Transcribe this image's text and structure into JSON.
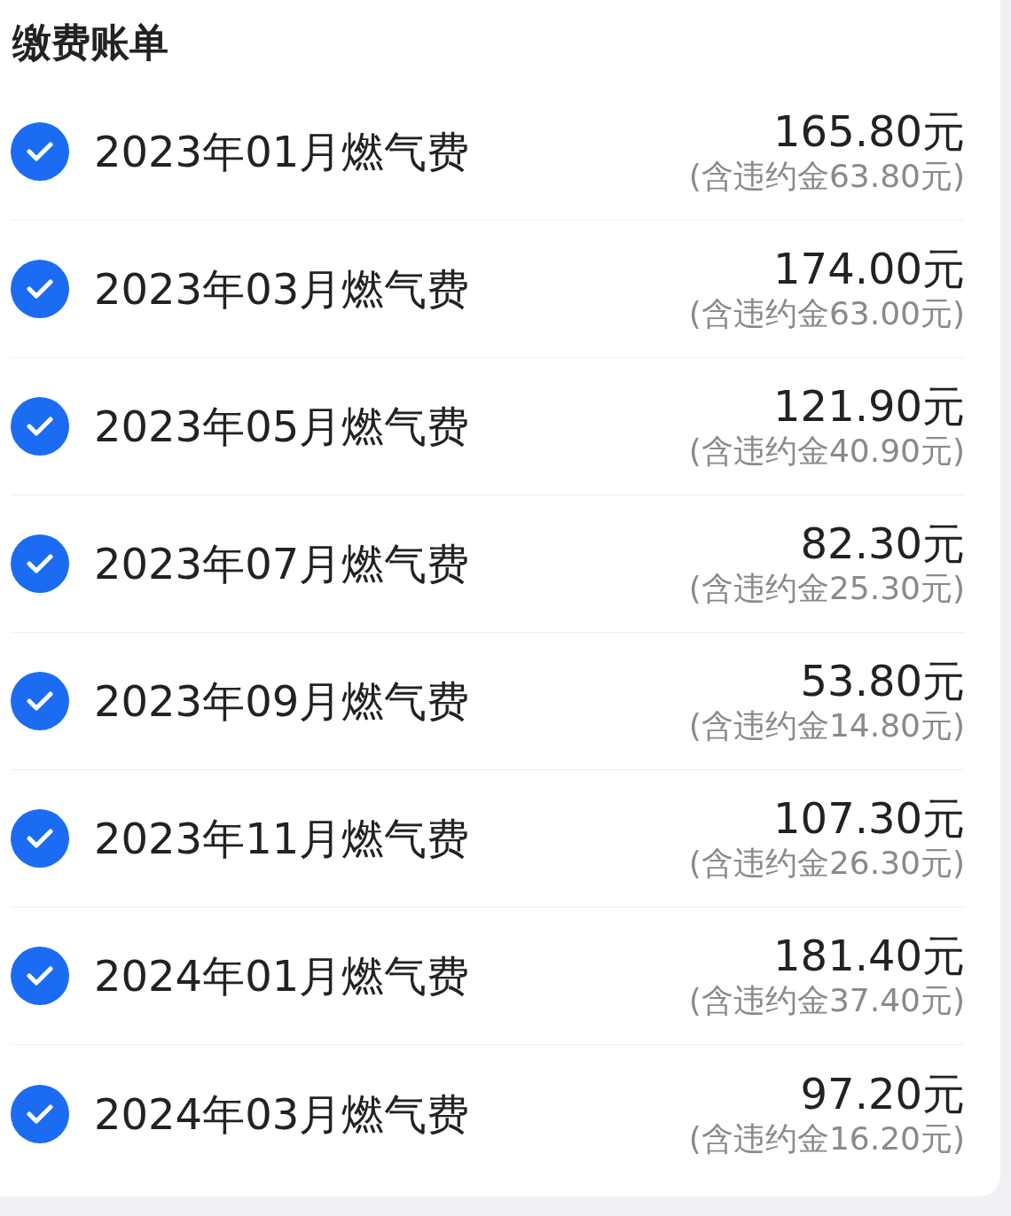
{
  "title": "缴费账单",
  "bills": [
    {
      "label": "2023年01月燃气费",
      "amount": "165.80元",
      "penalty": "(含违约金63.80元)",
      "checked": true
    },
    {
      "label": "2023年03月燃气费",
      "amount": "174.00元",
      "penalty": "(含违约金63.00元)",
      "checked": true
    },
    {
      "label": "2023年05月燃气费",
      "amount": "121.90元",
      "penalty": "(含违约金40.90元)",
      "checked": true
    },
    {
      "label": "2023年07月燃气费",
      "amount": "82.30元",
      "penalty": "(含违约金25.30元)",
      "checked": true
    },
    {
      "label": "2023年09月燃气费",
      "amount": "53.80元",
      "penalty": "(含违约金14.80元)",
      "checked": true
    },
    {
      "label": "2023年11月燃气费",
      "amount": "107.30元",
      "penalty": "(含违约金26.30元)",
      "checked": true
    },
    {
      "label": "2024年01月燃气费",
      "amount": "181.40元",
      "penalty": "(含违约金37.40元)",
      "checked": true
    },
    {
      "label": "2024年03月燃气费",
      "amount": "97.20元",
      "penalty": "(含违约金16.20元)",
      "checked": true
    }
  ]
}
